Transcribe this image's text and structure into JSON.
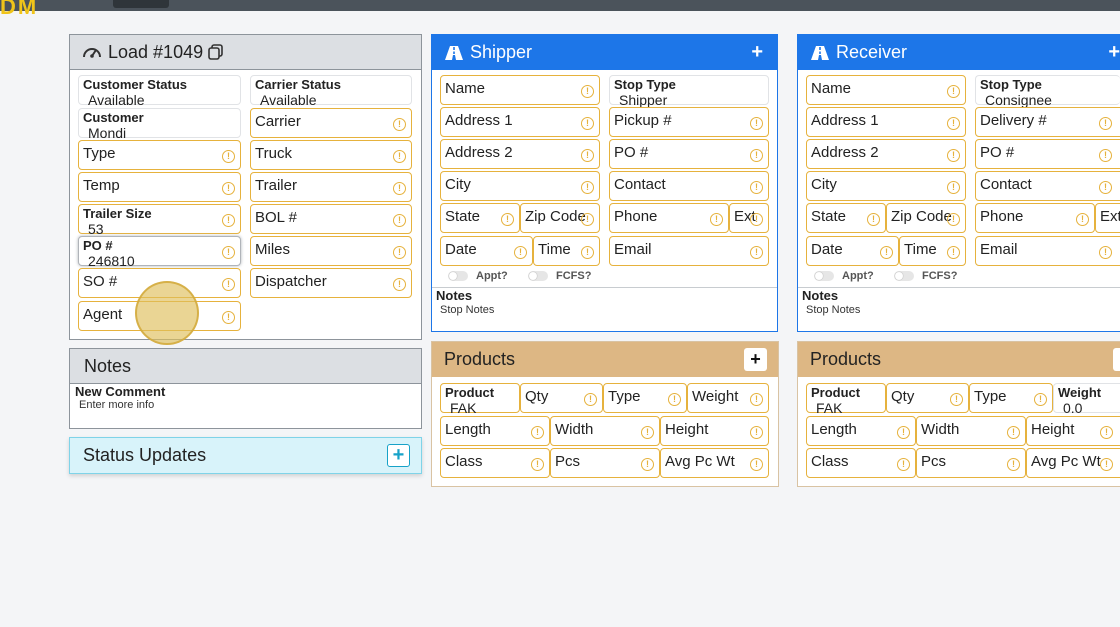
{
  "topbar": {
    "logo": "DM"
  },
  "load": {
    "title": "Load #1049",
    "customer_status": {
      "label": "Customer Status",
      "value": "Available"
    },
    "carrier_status": {
      "label": "Carrier Status",
      "value": "Available"
    },
    "customer": {
      "label": "Customer",
      "value": "Mondi"
    },
    "carrier": "Carrier",
    "type": "Type",
    "truck": "Truck",
    "temp": "Temp",
    "trailer": "Trailer",
    "trailer_size": {
      "label": "Trailer Size",
      "value": "53"
    },
    "bol": "BOL #",
    "po": {
      "label": "PO #",
      "value": "246810"
    },
    "miles": "Miles",
    "so": "SO #",
    "dispatcher": "Dispatcher",
    "agent": "Agent"
  },
  "notes_panel": {
    "title": "Notes",
    "new_comment": "New Comment",
    "placeholder": "Enter more info"
  },
  "status_updates": {
    "title": "Status Updates",
    "add": "+"
  },
  "shipper": {
    "title": "Shipper",
    "add": "+",
    "name": "Name",
    "stop_type": {
      "label": "Stop Type",
      "value": "Shipper"
    },
    "address1": "Address 1",
    "ref": "Pickup #",
    "address2": "Address 2",
    "po": "PO #",
    "city": "City",
    "contact": "Contact",
    "state": "State",
    "zip": "Zip Code",
    "phone": "Phone",
    "ext": "Ext",
    "date": "Date",
    "time": "Time",
    "email": "Email",
    "appt": "Appt?",
    "fcfs": "FCFS?",
    "notes_label": "Notes",
    "notes_placeholder": "Stop Notes"
  },
  "receiver": {
    "title": "Receiver",
    "add": "+",
    "name": "Name",
    "stop_type": {
      "label": "Stop Type",
      "value": "Consignee"
    },
    "address1": "Address 1",
    "ref": "Delivery #",
    "address2": "Address 2",
    "po": "PO #",
    "city": "City",
    "contact": "Contact",
    "state": "State",
    "zip": "Zip Code",
    "phone": "Phone",
    "ext": "Ext",
    "date": "Date",
    "time": "Time",
    "email": "Email",
    "appt": "Appt?",
    "fcfs": "FCFS?",
    "notes_label": "Notes",
    "notes_placeholder": "Stop Notes"
  },
  "products_shipper": {
    "title": "Products",
    "add": "+",
    "product": {
      "label": "Product",
      "value": "FAK"
    },
    "qty": "Qty",
    "type": "Type",
    "weight": "Weight",
    "length": "Length",
    "width": "Width",
    "height": "Height",
    "class": "Class",
    "pcs": "Pcs",
    "avg": "Avg Pc Wt"
  },
  "products_receiver": {
    "title": "Products",
    "add": "+",
    "product": {
      "label": "Product",
      "value": "FAK"
    },
    "qty": "Qty",
    "type": "Type",
    "weight": {
      "label": "Weight",
      "value": "0.0"
    },
    "length": "Length",
    "width": "Width",
    "height": "Height",
    "class": "Class",
    "pcs": "Pcs",
    "avg": "Avg Pc Wt"
  },
  "colors": {
    "accent_blue": "#1d76e8",
    "products_tan": "#ddb784",
    "field_border": "#e6b23d",
    "status_bg": "#d8f3fa"
  },
  "icons": [
    "dashboard-icon",
    "copy-icon",
    "road-icon",
    "warning-icon",
    "plus-icon"
  ]
}
